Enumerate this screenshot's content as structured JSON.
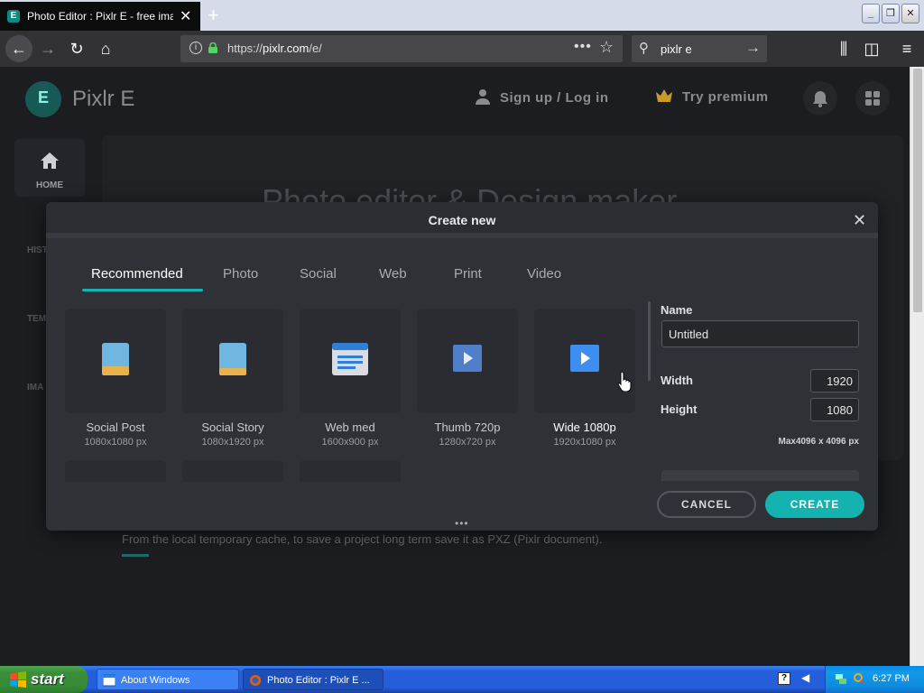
{
  "browser": {
    "tab_title": "Photo Editor : Pixlr E - free image",
    "new_tab": "+",
    "url_prefix": "https://",
    "url_domain": "pixlr.com",
    "url_path": "/e/",
    "search_value": "pixlr e"
  },
  "app": {
    "logo_letter": "E",
    "brand": "Pixlr E",
    "signup": "Sign up / Log in",
    "premium": "Try premium",
    "nav_home": "HOME",
    "nav_partials": [
      "HIST",
      "TEMP",
      "IMA"
    ],
    "hero_title": "Photo editor & Design maker",
    "cache_text": "From the local temporary cache, to save a project long term save it as PXZ (Pixlr document)."
  },
  "modal": {
    "title": "Create new",
    "tabs": [
      "Recommended",
      "Photo",
      "Social",
      "Web",
      "Print",
      "Video"
    ],
    "templates": [
      {
        "label": "Social Post",
        "size": "1080x1080 px"
      },
      {
        "label": "Social Story",
        "size": "1080x1920 px"
      },
      {
        "label": "Web med",
        "size": "1600x900 px"
      },
      {
        "label": "Thumb 720p",
        "size": "1280x720 px"
      },
      {
        "label": "Wide 1080p",
        "size": "1920x1080 px"
      }
    ],
    "name_label": "Name",
    "name_value": "Untitled",
    "width_label": "Width",
    "width_value": "1920",
    "height_label": "Height",
    "height_value": "1080",
    "max_text": "Max4096 x 4096 px",
    "cancel": "CANCEL",
    "create": "CREATE"
  },
  "taskbar": {
    "start": "start",
    "items": [
      "About Windows",
      "Photo Editor : Pixlr E ..."
    ],
    "help": "?",
    "clock": "6:27 PM"
  },
  "colors": {
    "accent": "#14b3b0",
    "modal_bg": "#2e3136",
    "page_bg": "#1b1d21"
  }
}
